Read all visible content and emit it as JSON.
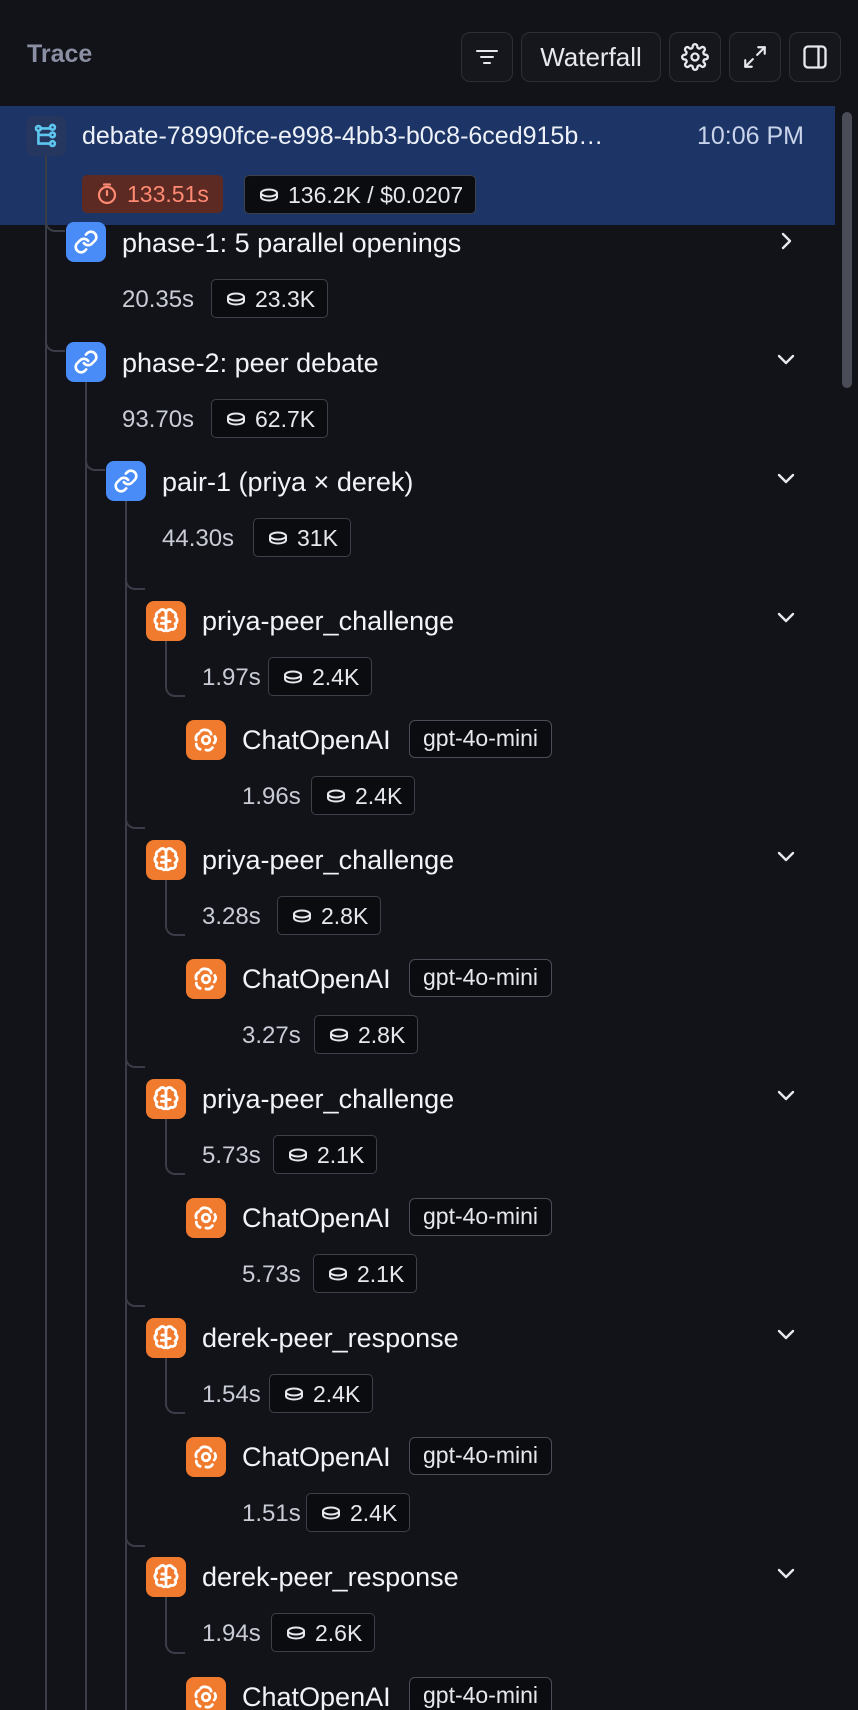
{
  "header": {
    "title": "Trace",
    "view_label": "Waterfall"
  },
  "root": {
    "name": "debate-78990fce-e998-4bb3-b0c8-6ced915b…",
    "time": "10:06 PM",
    "duration": "133.51s",
    "tokens_cost": "136.2K / $0.0207"
  },
  "rows": [
    {
      "name": "phase-1: 5 parallel openings",
      "duration": "20.35s",
      "tokens": "23.3K",
      "type": "chain",
      "expanded": false
    },
    {
      "name": "phase-2: peer debate",
      "duration": "93.70s",
      "tokens": "62.7K",
      "type": "chain",
      "expanded": true
    },
    {
      "name": "pair-1 (priya × derek)",
      "duration": "44.30s",
      "tokens": "31K",
      "type": "chain",
      "expanded": true
    },
    {
      "name": "priya-peer_challenge",
      "duration": "1.97s",
      "tokens": "2.4K",
      "type": "agent",
      "expanded": true
    },
    {
      "name": "ChatOpenAI",
      "model": "gpt-4o-mini",
      "duration": "1.96s",
      "tokens": "2.4K",
      "type": "llm"
    },
    {
      "name": "priya-peer_challenge",
      "duration": "3.28s",
      "tokens": "2.8K",
      "type": "agent",
      "expanded": true
    },
    {
      "name": "ChatOpenAI",
      "model": "gpt-4o-mini",
      "duration": "3.27s",
      "tokens": "2.8K",
      "type": "llm"
    },
    {
      "name": "priya-peer_challenge",
      "duration": "5.73s",
      "tokens": "2.1K",
      "type": "agent",
      "expanded": true
    },
    {
      "name": "ChatOpenAI",
      "model": "gpt-4o-mini",
      "duration": "5.73s",
      "tokens": "2.1K",
      "type": "llm"
    },
    {
      "name": "derek-peer_response",
      "duration": "1.54s",
      "tokens": "2.4K",
      "type": "agent",
      "expanded": true
    },
    {
      "name": "ChatOpenAI",
      "model": "gpt-4o-mini",
      "duration": "1.51s",
      "tokens": "2.4K",
      "type": "llm"
    },
    {
      "name": "derek-peer_response",
      "duration": "1.94s",
      "tokens": "2.6K",
      "type": "agent",
      "expanded": true
    },
    {
      "name": "ChatOpenAI",
      "model": "gpt-4o-mini",
      "duration": "",
      "tokens": "",
      "type": "llm"
    }
  ]
}
